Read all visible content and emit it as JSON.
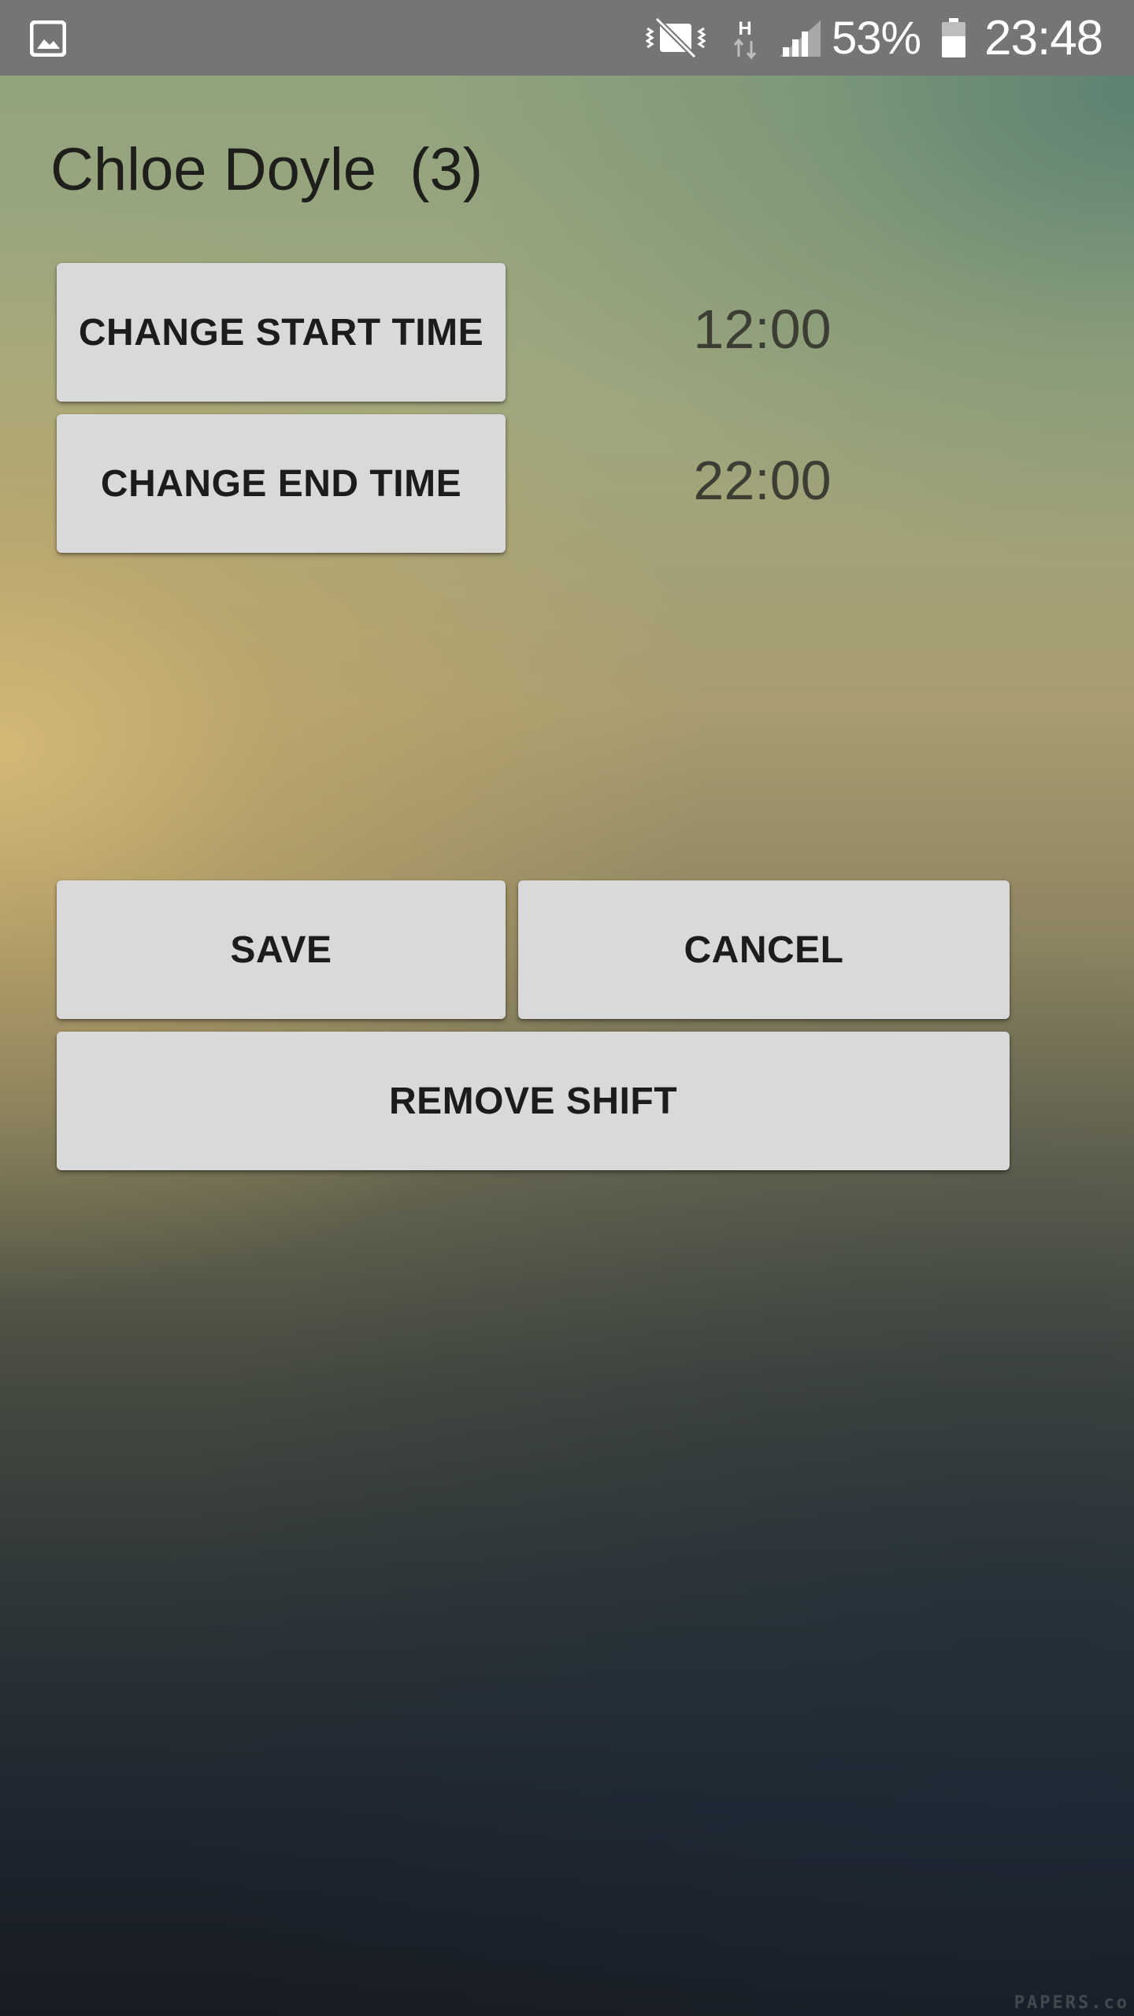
{
  "status_bar": {
    "battery_percent": "53%",
    "time": "23:48",
    "network_type": "H",
    "icons": [
      "gallery-icon",
      "vibrate-mute-icon",
      "network-h-icon",
      "signal-icon",
      "battery-icon"
    ]
  },
  "header": {
    "title": "Chloe Doyle  (3)"
  },
  "shift": {
    "change_start_label": "CHANGE START TIME",
    "start_time": "12:00",
    "change_end_label": "CHANGE END TIME",
    "end_time": "22:00"
  },
  "actions": {
    "save_label": "SAVE",
    "cancel_label": "CANCEL",
    "remove_label": "REMOVE SHIFT"
  },
  "wallpaper": {
    "watermark": "PAPERS.co"
  },
  "colors": {
    "status_bar": "#757575",
    "button_bg": "#d9d9d9",
    "button_text": "#1c1c1c",
    "title_text": "#1e1f1a",
    "time_text": "#3c3e33"
  }
}
